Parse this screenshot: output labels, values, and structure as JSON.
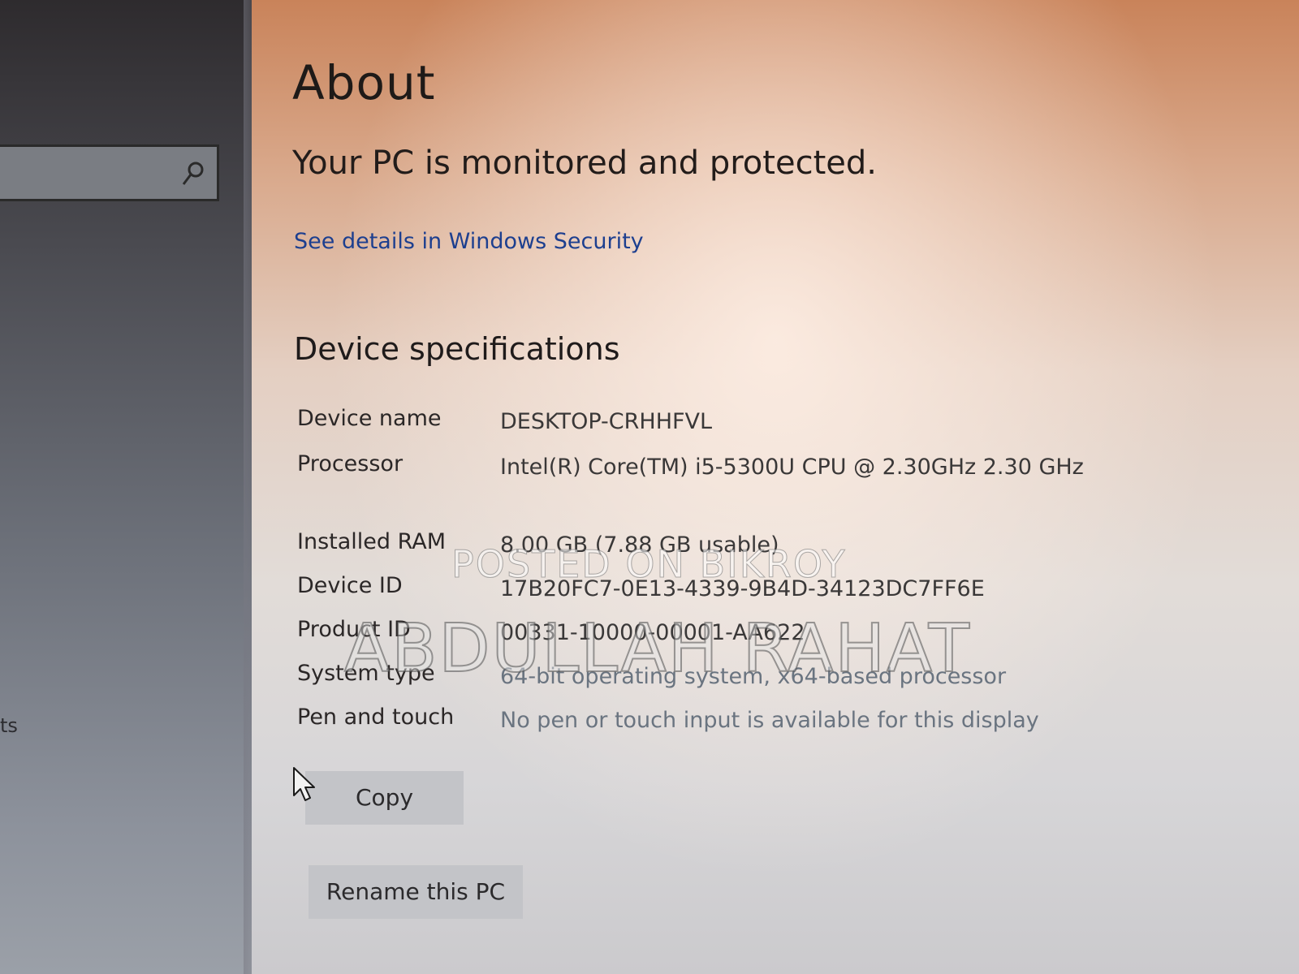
{
  "header": {
    "title": "About",
    "protection_status": "Your PC is monitored and protected.",
    "security_link": "See details in Windows Security"
  },
  "search": {
    "icon": "search-icon"
  },
  "sidebar": {
    "partial_text": "ts"
  },
  "device_specs": {
    "heading": "Device specifications",
    "rows": [
      {
        "label": "Device name",
        "value": "DESKTOP-CRHHFVL"
      },
      {
        "label": "Processor",
        "value": "Intel(R) Core(TM) i5-5300U CPU @ 2.30GHz   2.30 GHz"
      },
      {
        "label": "Installed RAM",
        "value": "8.00 GB (7.88 GB usable)"
      },
      {
        "label": "Device ID",
        "value": "17B20FC7-0E13-4339-9B4D-34123DC7FF6E"
      },
      {
        "label": "Product ID",
        "value": "00331-10000-00001-AA622"
      },
      {
        "label": "System type",
        "value": "64-bit operating system, x64-based processor"
      },
      {
        "label": "Pen and touch",
        "value": "No pen or touch input is available for this display"
      }
    ]
  },
  "buttons": {
    "copy": "Copy",
    "rename": "Rename this PC"
  },
  "watermark": {
    "line1": "POSTED ON BIKROY",
    "line2": "ABDULLAH RAHAT"
  },
  "colors": {
    "link": "#1d3f8f",
    "button_bg": "#c3c4c8"
  }
}
